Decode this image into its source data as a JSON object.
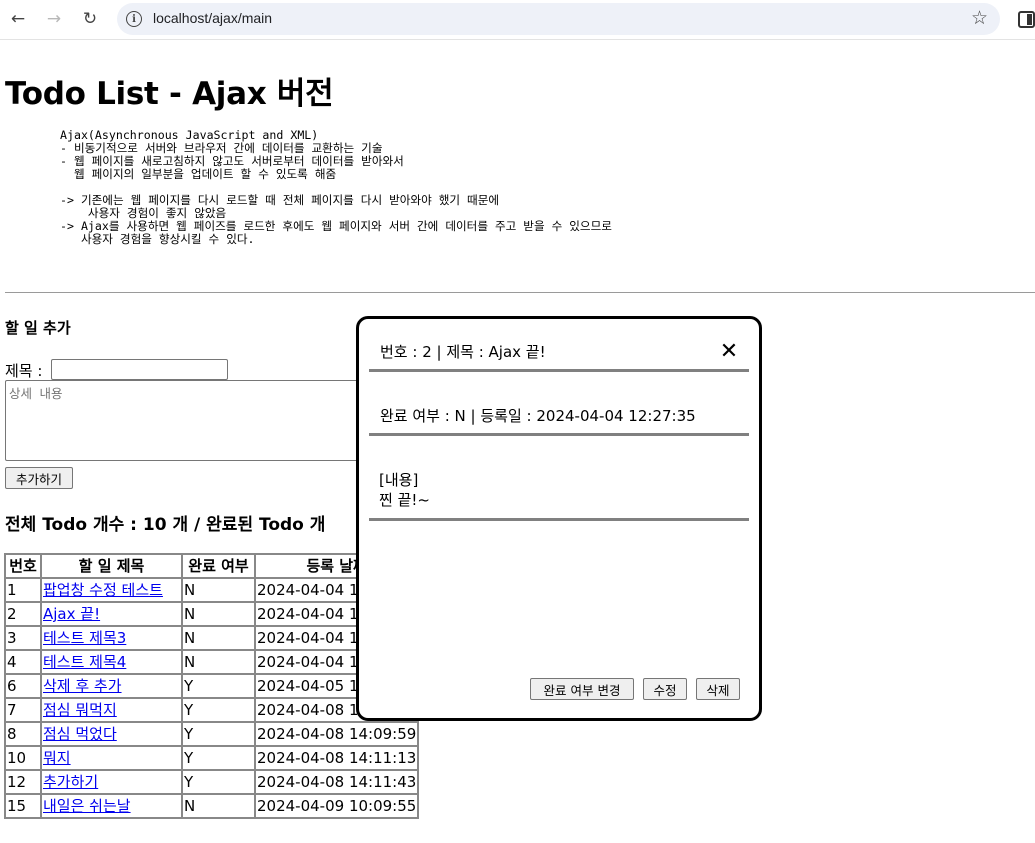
{
  "browser": {
    "url": "localhost/ajax/main"
  },
  "page": {
    "title": "Todo List - Ajax 버전",
    "description": "Ajax(Asynchronous JavaScript and XML)\n- 비동기적으로 서버와 브라우저 간에 데이터를 교환하는 기술\n- 웹 페이지를 새로고침하지 않고도 서버로부터 데이터를 받아와서\n  웹 페이지의 일부분을 업데이트 할 수 있도록 해줌\n\n-> 기존에는 웹 페이지를 다시 로드할 때 전체 페이지를 다시 받아와야 했기 때문에\n    사용자 경험이 좋지 않았음\n-> Ajax를 사용하면 웹 페이즈를 로드한 후에도 웹 페이지와 서버 간에 데이터를 주고 받을 수 있으므로\n   사용자 경험을 향상시킬 수 있다."
  },
  "add_form": {
    "heading": "할 일 추가",
    "title_label": "제목 :",
    "title_value": "",
    "content_placeholder": "상세 내용",
    "add_button": "추가하기"
  },
  "summary": {
    "text": "전체 Todo 개수 : 10 개 / 완료된 Todo 개"
  },
  "table": {
    "headers": [
      "번호",
      "할 일 제목",
      "완료 여부",
      "등록 날짜"
    ],
    "rows": [
      {
        "no": "1",
        "title": "팝업창 수정 테스트",
        "done": "N",
        "date": "2024-04-04 12:27:35"
      },
      {
        "no": "2",
        "title": "Ajax 끝!",
        "done": "N",
        "date": "2024-04-04 12:27:35"
      },
      {
        "no": "3",
        "title": "테스트 제목3",
        "done": "N",
        "date": "2024-04-04 12:27:35"
      },
      {
        "no": "4",
        "title": "테스트 제목4",
        "done": "N",
        "date": "2024-04-04 17:27:35"
      },
      {
        "no": "6",
        "title": "삭제 후 추가",
        "done": "Y",
        "date": "2024-04-05 12:27:35"
      },
      {
        "no": "7",
        "title": "점심 뭐먹지",
        "done": "Y",
        "date": "2024-04-08 12:27:35"
      },
      {
        "no": "8",
        "title": "점심 먹었다",
        "done": "Y",
        "date": "2024-04-08 14:09:59"
      },
      {
        "no": "10",
        "title": "뭐지",
        "done": "Y",
        "date": "2024-04-08 14:11:13"
      },
      {
        "no": "12",
        "title": "추가하기",
        "done": "Y",
        "date": "2024-04-08 14:11:43"
      },
      {
        "no": "15",
        "title": "내일은 쉬는날",
        "done": "N",
        "date": "2024-04-09 10:09:55"
      }
    ]
  },
  "popup": {
    "header": "번호 : 2 | 제목 : Ajax 끝!",
    "close_symbol": "✕",
    "meta": "완료 여부 : N | 등록일 : 2024-04-04 12:27:35",
    "content_label": "[내용]",
    "content_text": "찐 끝!~",
    "toggle_button": "완료 여부 변경",
    "edit_button": "수정",
    "delete_button": "삭제"
  }
}
